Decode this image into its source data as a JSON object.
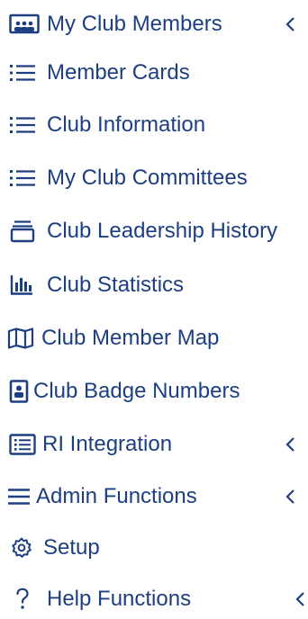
{
  "menu": {
    "items": [
      {
        "label": "My Club Members",
        "icon": "members-group-icon",
        "expandable": true
      },
      {
        "label": "Member Cards",
        "icon": "list-icon",
        "expandable": false
      },
      {
        "label": "Club Information",
        "icon": "list-icon",
        "expandable": false
      },
      {
        "label": "My Club Committees",
        "icon": "list-icon",
        "expandable": false
      },
      {
        "label": "Club Leadership History",
        "icon": "archive-tray-icon",
        "expandable": false
      },
      {
        "label": "Club Statistics",
        "icon": "bar-chart-icon",
        "expandable": false
      },
      {
        "label": "Club Member Map",
        "icon": "map-icon",
        "expandable": false
      },
      {
        "label": "Club Badge Numbers",
        "icon": "badge-icon",
        "expandable": false
      },
      {
        "label": "RI Integration",
        "icon": "list-window-icon",
        "expandable": true
      },
      {
        "label": "Admin Functions",
        "icon": "hamburger-menu-icon",
        "expandable": true
      },
      {
        "label": "Setup",
        "icon": "gear-icon",
        "expandable": false
      },
      {
        "label": "Help Functions",
        "icon": "question-icon",
        "expandable": true
      }
    ],
    "colors": {
      "text": "#1d3f82",
      "background": "#ffffff"
    }
  }
}
